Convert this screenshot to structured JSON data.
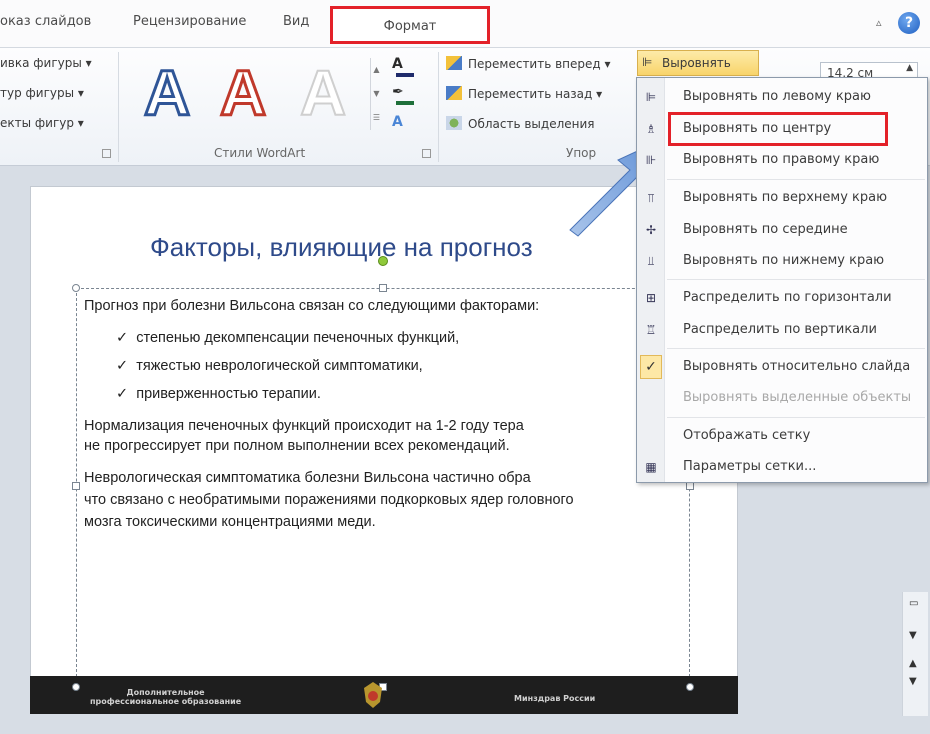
{
  "tabs": {
    "slideshow": "оказ слайдов",
    "review": "Рецензирование",
    "view": "Вид",
    "format": "Формат"
  },
  "ribbon": {
    "shape_fill": "ивка фигуры ▾",
    "shape_outline": "тур фигуры ▾",
    "shape_effects": "екты фигур ▾",
    "wordart_letters": [
      "A",
      "A",
      "A"
    ],
    "wordart_group": "Стили WordArt",
    "text_fill_glyph": "A",
    "text_outline_glyph": "✒",
    "text_effects_glyph": "A",
    "bring_forward": "Переместить вперед",
    "send_backward": "Переместить назад",
    "selection_pane": "Область выделения",
    "arrange_group": "Упор",
    "align_button": "Выровнять",
    "size_value": "14,2 см"
  },
  "slide": {
    "title": "Факторы, влияющие на прогноз",
    "intro": "Прогноз при болезни Вильсона связан со следующими факторами:",
    "bullets": [
      "степенью декомпенсации печеночных функций,",
      "тяжестью неврологической симптоматики,",
      "приверженностью терапии."
    ],
    "para2_line1": "Нормализация печеночных функций происходит на 1-2 году тера",
    "para2_line2": "не прогрессирует при полном выполнении всех рекомендаций.",
    "para3_line1": "Неврологическая симптоматика болезни Вильсона частично обра",
    "para3_line2": "что связано с необратимыми поражениями подкорковых ядер головного",
    "para3_line3": "мозга токсическими концентрациями меди.",
    "footer_left_1": "Дополнительное",
    "footer_left_2": "профессиональное образование",
    "footer_right": "Минздрав России"
  },
  "menu": {
    "items": [
      {
        "label": "Выровнять по левому краю",
        "icon": "align-left-icon",
        "glyph": "⊫"
      },
      {
        "label": "Выровнять по центру",
        "icon": "align-center-icon",
        "glyph": "♗"
      },
      {
        "label": "Выровнять по правому краю",
        "icon": "align-right-icon",
        "glyph": "⊪"
      },
      {
        "label": "Выровнять по верхнему краю",
        "icon": "align-top-icon",
        "glyph": "⫪"
      },
      {
        "label": "Выровнять по середине",
        "icon": "align-middle-icon",
        "glyph": "✢"
      },
      {
        "label": "Выровнять по нижнему краю",
        "icon": "align-bottom-icon",
        "glyph": "⫫"
      },
      {
        "label": "Распределить по горизонтали",
        "icon": "distribute-horizontal-icon",
        "glyph": "⊞"
      },
      {
        "label": "Распределить по вертикали",
        "icon": "distribute-vertical-icon",
        "glyph": "♖"
      },
      {
        "label": "Выровнять относительно слайда",
        "icon": "check-icon",
        "glyph": "✓"
      },
      {
        "label": "Выровнять выделенные объекты",
        "icon": "",
        "glyph": ""
      },
      {
        "label": "Отображать сетку",
        "icon": "",
        "glyph": ""
      },
      {
        "label": "Параметры сетки...",
        "icon": "grid-icon",
        "glyph": "▦"
      }
    ]
  },
  "colors": {
    "highlight": "#e32129",
    "title": "#2e4a8a",
    "align_button": "#f8d46b"
  }
}
